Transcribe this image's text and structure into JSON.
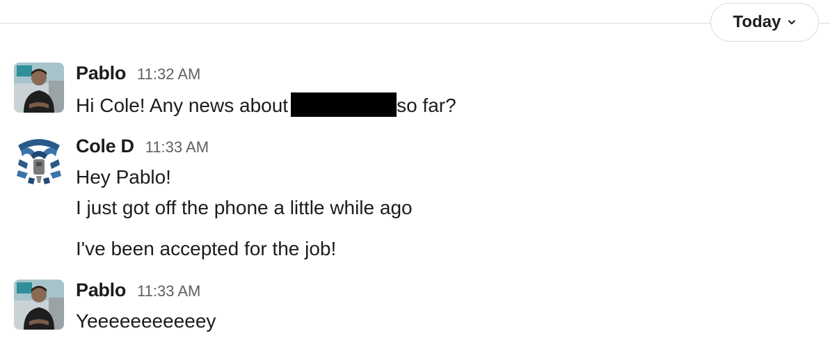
{
  "day_divider": {
    "label": "Today",
    "icon": "chevron-down-icon"
  },
  "messages": [
    {
      "sender": "Pablo",
      "time": "11:32 AM",
      "avatar": "pablo-avatar",
      "lines": [
        {
          "before": "Hi Cole! Any news about",
          "redacted": true,
          "after": "so far?"
        }
      ]
    },
    {
      "sender": "Cole D",
      "time": "11:33 AM",
      "avatar": "cole-avatar",
      "lines": [
        {
          "text": "Hey Pablo!"
        },
        {
          "text": "I just got off the phone a little while ago"
        },
        {
          "text": "I've been accepted for the job!"
        }
      ]
    },
    {
      "sender": "Pablo",
      "time": "11:33 AM",
      "avatar": "pablo-avatar",
      "lines": [
        {
          "text": "Yeeeeeeeeeeey"
        }
      ]
    }
  ],
  "colors": {
    "text": "#1d1c1d",
    "timestamp": "#616061",
    "divider": "#dddddd",
    "redaction": "#000000"
  }
}
